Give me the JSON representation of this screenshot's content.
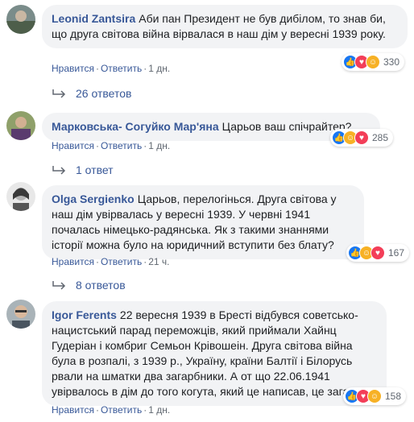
{
  "comments": [
    {
      "author": "Leonid Zantsira",
      "text": "Аби пан Президент не був дибілом, то знав би, що друга світова війна вірвалася в наш дім у вересні 1939 року.",
      "reactions": "330",
      "like": "Нравится",
      "reply": "Ответить",
      "time": "1 дн.",
      "replies": "26 ответов"
    },
    {
      "author": "Марковська- Согуйко Мар'яна",
      "text": "Царьов ваш спічрайтер?",
      "reactions": "285",
      "like": "Нравится",
      "reply": "Ответить",
      "time": "1 дн.",
      "replies": "1 ответ"
    },
    {
      "author": "Olga Sergienko",
      "text": "Царьов, перелогінься. Друга світова у наш дім увірвалась у вересні 1939. У червні 1941 почалась німецько-радянська. Як з такими знаннями історії можна було на юридичний вступити без блату?",
      "reactions": "167",
      "like": "Нравится",
      "reply": "Ответить",
      "time": "21 ч.",
      "replies": "8 ответов"
    },
    {
      "author": "Igor Ferents",
      "text": "22 вересня 1939 в Бресті відбувся советсько-нацистський парад переможців, який приймали Хайнц Гудеріан і комбриг Семьон Крівошеін. Друга світова війна була в розпалі, з 1939 р., Україну, країни Балтії і Білорусь рвали на шматки два загарбники. А от що 22.06.1941 увірвалось в дім до того когута, який це написав, це загадка.",
      "reactions": "158",
      "like": "Нравится",
      "reply": "Ответить",
      "time": "1 дн."
    }
  ],
  "separator": "·",
  "reaction_icons": [
    "like-icon",
    "love-icon",
    "haha-icon"
  ],
  "colors": {
    "link": "#385898",
    "bubble": "#f2f3f5",
    "meta": "#606770",
    "like": "#1877f2",
    "love": "#f33e58",
    "haha": "#f7b125"
  }
}
